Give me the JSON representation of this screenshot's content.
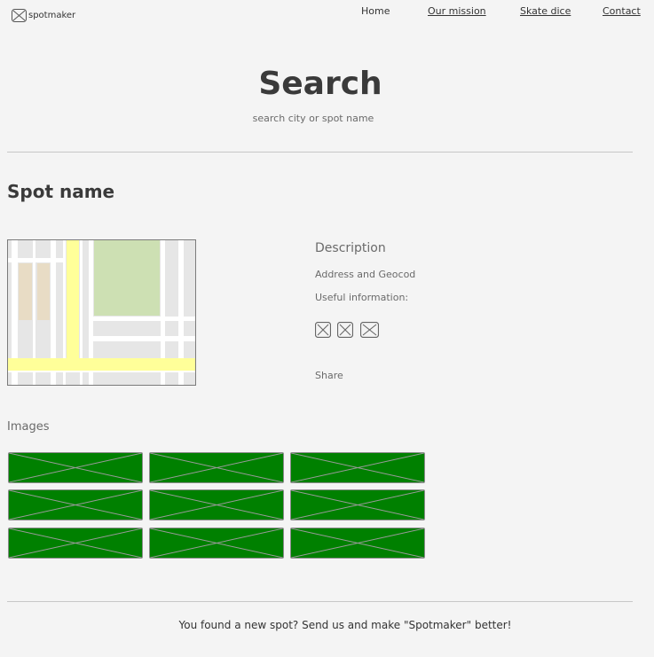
{
  "header": {
    "logo_icon": "image-placeholder-icon",
    "logo_text": "spotmaker",
    "nav": {
      "home": "Home",
      "mission": "Our mission",
      "dice": "Skate dice",
      "contact": "Contact"
    }
  },
  "search": {
    "title": "Search",
    "placeholder": "search city or spot name"
  },
  "spot": {
    "name": "Spot name",
    "description_title": "Description",
    "address": "Address and Geocod",
    "useful_info": "Useful information:",
    "social_icons": [
      "image-placeholder-icon",
      "image-placeholder-icon",
      "image-placeholder-icon"
    ],
    "share": "Share"
  },
  "images": {
    "label": "Images",
    "thumbnail_count": 9,
    "thumbnail_color": "#008000"
  },
  "footer": {
    "text": "You found a new spot? Send us  and make \"Spotmaker\" better!"
  },
  "colors": {
    "background": "#f4f4f4",
    "map_road_yellow": "#ffff99",
    "map_park_green": "#cde0b3",
    "map_block_tan": "#e8dcc5"
  }
}
